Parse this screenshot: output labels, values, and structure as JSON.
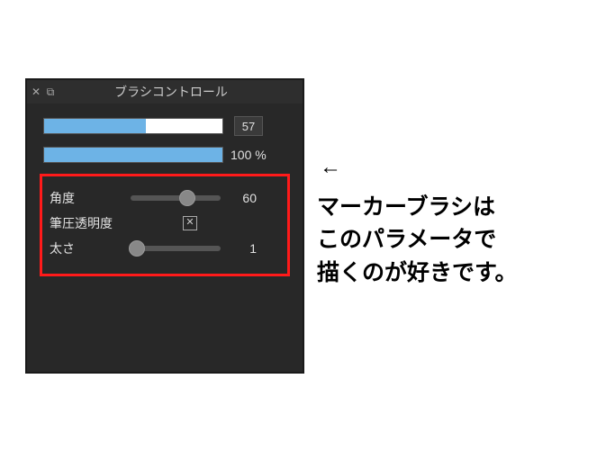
{
  "panel": {
    "title": "ブラシコントロール",
    "close_glyph": "✕",
    "popout_glyph": "⧉",
    "opacity": {
      "value": 57,
      "fill_pct": 57
    },
    "flow": {
      "value": 100,
      "suffix": "%",
      "fill_pct": 100
    },
    "params": {
      "angle": {
        "label": "角度",
        "value": 60,
        "knob_pct": 62
      },
      "pressure_opacity": {
        "label": "筆圧透明度",
        "checked_glyph": "✕"
      },
      "thickness": {
        "label": "太さ",
        "value": 1,
        "knob_pct": 6
      }
    }
  },
  "annotation": {
    "arrow": "←",
    "line1": "マーカーブラシは",
    "line2": "このパラメータで",
    "line3": "描くのが好きです。"
  }
}
